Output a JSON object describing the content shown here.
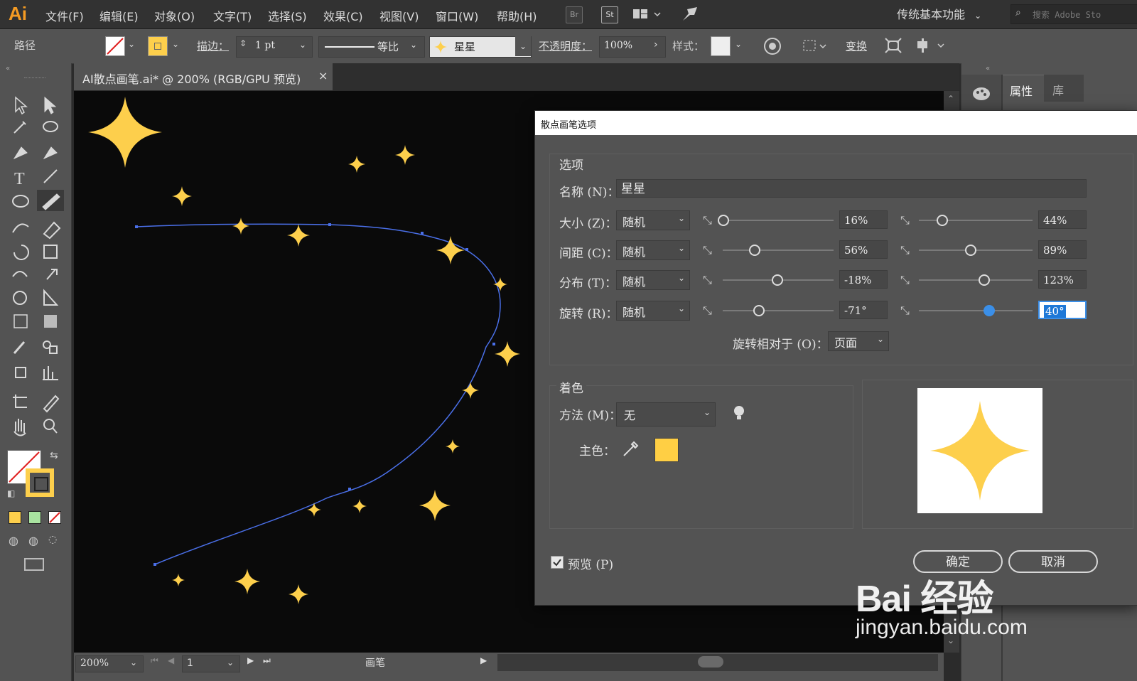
{
  "app": {
    "logo": "Ai",
    "menu": [
      "文件(F)",
      "编辑(E)",
      "对象(O)",
      "文字(T)",
      "选择(S)",
      "效果(C)",
      "视图(V)",
      "窗口(W)",
      "帮助(H)"
    ],
    "toolbar_icons": {
      "br": "Br",
      "st": "St"
    },
    "workspace": "传统基本功能",
    "search_placeholder": "搜索 Adobe Sto"
  },
  "control_bar": {
    "object_type": "路径",
    "stroke_label": "描边：",
    "stroke_weight": "1 pt",
    "stroke_profile": "等比",
    "brush_name": "星星",
    "opacity_label": "不透明度：",
    "opacity_value": "100%",
    "style_label": "样式：",
    "transform_label": "变换"
  },
  "document": {
    "tab_title": "AI散点画笔.ai* @ 200% (RGB/GPU 预览)",
    "close": "×"
  },
  "status_bar": {
    "zoom": "200%",
    "page": "1",
    "tool": "画笔"
  },
  "right_panel": {
    "tabs": [
      "属性",
      "库"
    ]
  },
  "dialog": {
    "title": "散点画笔选项",
    "options_section": "选项",
    "name_label": "名称 (N)：",
    "name_value": "星星",
    "rows": [
      {
        "label": "大小 (Z)：",
        "mode": "随机",
        "min": "16%",
        "max": "44%",
        "min_pos": 0.0,
        "max_pos": 0.2
      },
      {
        "label": "间距 (C)：",
        "mode": "随机",
        "min": "56%",
        "max": "89%",
        "min_pos": 0.28,
        "max_pos": 0.45
      },
      {
        "label": "分布 (T)：",
        "mode": "随机",
        "min": "-18%",
        "max": "123%",
        "min_pos": 0.49,
        "max_pos": 0.57
      },
      {
        "label": "旋转 (R)：",
        "mode": "随机",
        "min": "-71°",
        "max": "40°",
        "min_pos": 0.32,
        "max_pos": 0.61
      }
    ],
    "rotation_relative_label": "旋转相对于 (O)：",
    "rotation_relative_value": "页面",
    "colorization_section": "着色",
    "method_label": "方法 (M)：",
    "method_value": "无",
    "key_color_label": "主色：",
    "key_color": "#ffcf44",
    "preview_label": "预览 (P)",
    "preview_checked": true,
    "ok_label": "确定",
    "cancel_label": "取消"
  },
  "colors": {
    "star": "#fdcf4c",
    "path": "#4a6fe8",
    "accent": "#3b8fe8",
    "logo": "#f59b23"
  },
  "watermark": {
    "brand": "Bai  经验",
    "url": "jingyan.baidu.com"
  }
}
